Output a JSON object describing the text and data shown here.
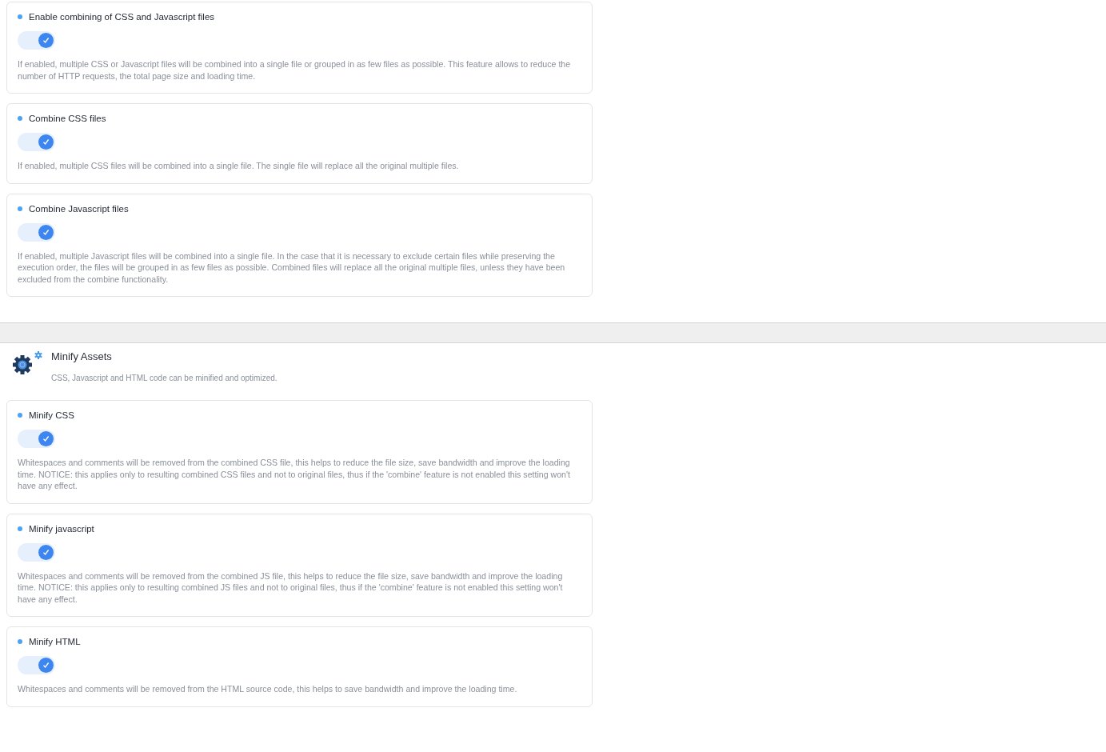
{
  "groups": [
    {
      "kind": "cards",
      "settings": [
        {
          "title": "Enable combining of CSS and Javascript files",
          "on": true,
          "description": "If enabled, multiple CSS or Javascript files will be combined into a single file or grouped in as few files as possible. This feature allows to reduce the number of HTTP requests, the total page size and loading time."
        },
        {
          "title": "Combine CSS files",
          "on": true,
          "description": "If enabled, multiple CSS files will be combined into a single file. The single file will replace all the original multiple files."
        },
        {
          "title": "Combine Javascript files",
          "on": true,
          "description": "If enabled, multiple Javascript files will be combined into a single file. In the case that it is necessary to exclude certain files while preserving the execution order, the files will be grouped in as few files as possible. Combined files will replace all the original multiple files, unless they have been excluded from the combine functionality."
        }
      ]
    },
    {
      "kind": "section",
      "title": "Minify Assets",
      "subtitle": "CSS, Javascript and HTML code can be minified and optimized.",
      "settings": [
        {
          "title": "Minify CSS",
          "on": true,
          "description": "Whitespaces and comments will be removed from the combined CSS file, this helps to reduce the file size, save bandwidth and improve the loading time. NOTICE: this applies only to resulting combined CSS files and not to original files, thus if the 'combine' feature is not enabled this setting won't have any effect."
        },
        {
          "title": "Minify javascript",
          "on": true,
          "description": "Whitespaces and comments will be removed from the combined JS file, this helps to reduce the file size, save bandwidth and improve the loading time. NOTICE: this applies only to resulting combined JS files and not to original files, thus if the 'combine' feature is not enabled this setting won't have any effect."
        },
        {
          "title": "Minify HTML",
          "on": true,
          "description": "Whitespaces and comments will be removed from the HTML source code, this helps to save bandwidth and improve the loading time."
        }
      ]
    }
  ]
}
